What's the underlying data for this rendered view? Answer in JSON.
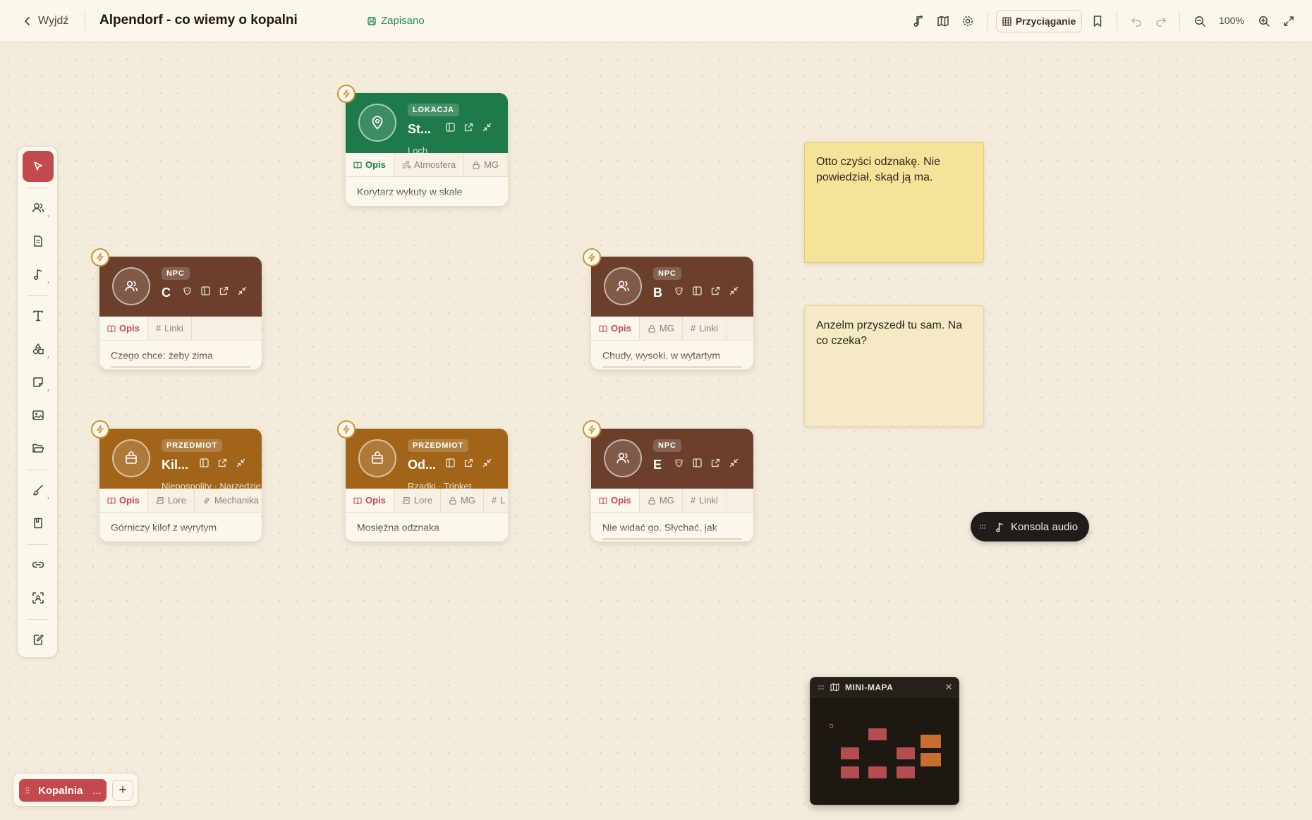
{
  "header": {
    "exit_label": "Wyjdź",
    "title": "Alpendorf - co wiemy o kopalni",
    "save_status": "Zapisano",
    "snap_label": "Przyciąganie",
    "zoom_level": "100%",
    "icons": [
      "music-icon",
      "map-icon",
      "settings-icon",
      "bookmark-icon",
      "undo-icon",
      "redo-icon",
      "zoom-out-icon",
      "zoom-in-icon",
      "fullscreen-icon"
    ]
  },
  "toolbar": {
    "tools": [
      "select",
      "characters",
      "document",
      "music",
      "text",
      "shapes",
      "page",
      "image",
      "folder",
      "draw",
      "book",
      "link",
      "focus",
      "edit-notes"
    ]
  },
  "cards": [
    {
      "badge": "LOKACJA",
      "name": "St...",
      "tags": "Loch",
      "tabs": [
        "Opis",
        "Atmosfera",
        "MG"
      ],
      "body": "Korytarz wykuty w skale",
      "color": "#1f7a4a"
    },
    {
      "badge": "NPC",
      "name": "C",
      "tags": "",
      "tabs": [
        "Opis",
        "Linki"
      ],
      "body": "Czego chce: żeby zima",
      "color": "#6b3f2b"
    },
    {
      "badge": "NPC",
      "name": "B",
      "tags": "",
      "tabs": [
        "Opis",
        "MG",
        "Linki"
      ],
      "body": "Chudy, wysoki, w wytartym",
      "color": "#6b3f2b"
    },
    {
      "badge": "PRZEDMIOT",
      "name": "Kil...",
      "tags": "Niepospolity · Narzędzie",
      "tabs": [
        "Opis",
        "Lore",
        "Mechanika"
      ],
      "body": "Górniczy kilof z wyrytym",
      "color": "#a26419"
    },
    {
      "badge": "PRZEDMIOT",
      "name": "Od...",
      "tags": "Rzadki · Trinket",
      "tabs": [
        "Opis",
        "Lore",
        "MG",
        "L"
      ],
      "body": "Mosiężna odznaka",
      "color": "#a26419"
    },
    {
      "badge": "NPC",
      "name": "E",
      "tags": "",
      "tabs": [
        "Opis",
        "MG",
        "Linki"
      ],
      "body": "Nie widać go. Słychać, jak",
      "color": "#6b3f2b"
    }
  ],
  "notes": [
    {
      "text": "Otto czyści odznakę. Nie powiedział, skąd ją ma.",
      "color": "#f6e39a"
    },
    {
      "text": "Anzelm przyszedł tu sam. Na co czeka?",
      "color": "#f6e9c6"
    }
  ],
  "audio_console": {
    "label": "Konsola audio"
  },
  "minimap": {
    "title": "MINI-MAPA"
  },
  "pages": {
    "active_tab": "Kopalnia",
    "more_label": "...",
    "add_label": "+"
  },
  "colors": {
    "accent": "#c24a4f",
    "location": "#1f7a4a",
    "npc": "#6b3f2b",
    "item": "#a26419",
    "bolt": "#c99532",
    "saved": "#2f8a55"
  }
}
